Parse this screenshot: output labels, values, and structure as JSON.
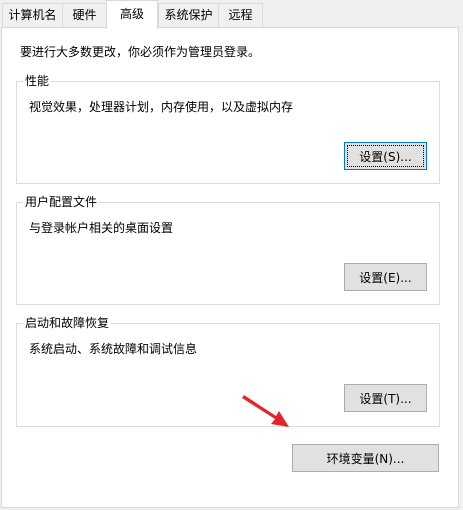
{
  "tabs": [
    {
      "label": "计算机名"
    },
    {
      "label": "硬件"
    },
    {
      "label": "高级",
      "active": true
    },
    {
      "label": "系统保护"
    },
    {
      "label": "远程"
    }
  ],
  "admin_note": "要进行大多数更改，你必须作为管理员登录。",
  "performance": {
    "title": "性能",
    "description": "视觉效果，处理器计划，内存使用，以及虚拟内存",
    "button": "设置(S)..."
  },
  "user_profiles": {
    "title": "用户配置文件",
    "description": "与登录帐户相关的桌面设置",
    "button": "设置(E)..."
  },
  "startup_recovery": {
    "title": "启动和故障恢复",
    "description": "系统启动、系统故障和调试信息",
    "button": "设置(T)..."
  },
  "env_button": "环境变量(N)...",
  "colors": {
    "annotation_arrow": "#e5242a"
  }
}
